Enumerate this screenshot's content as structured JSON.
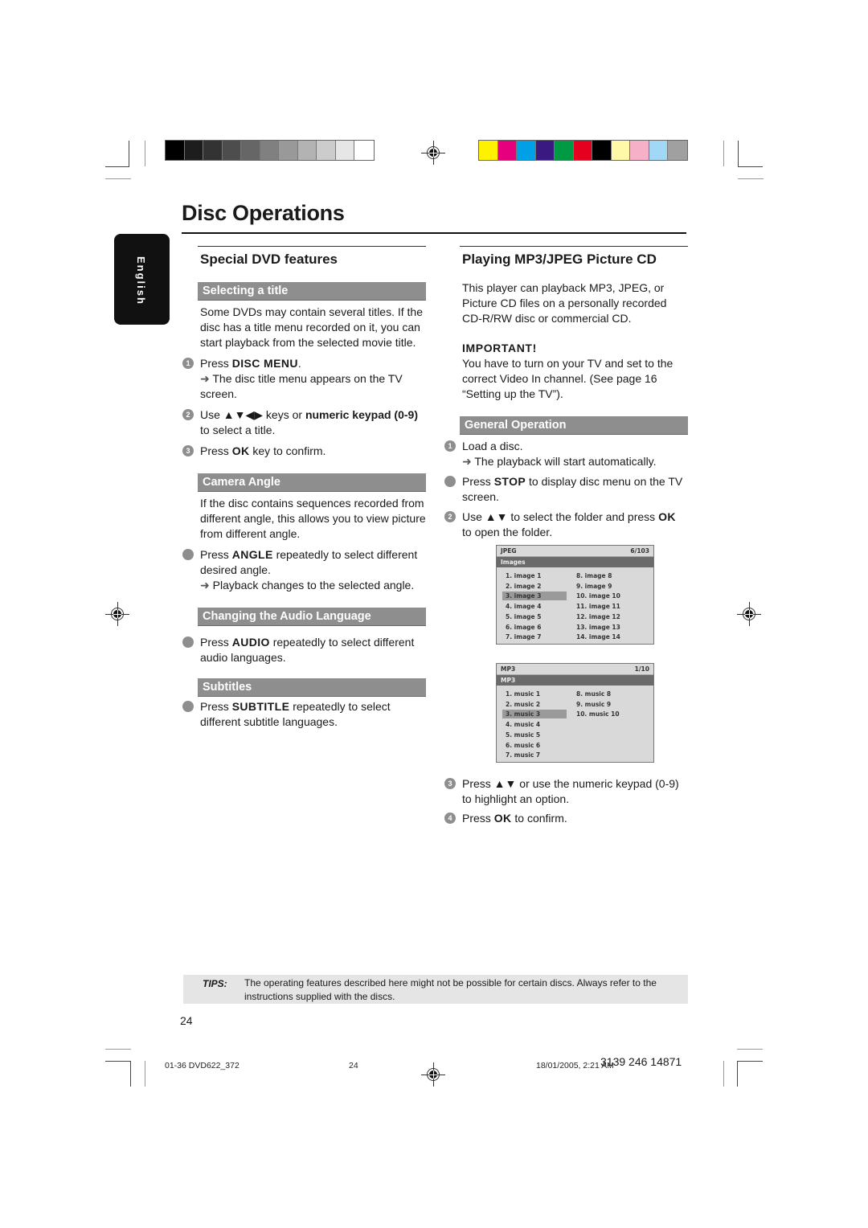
{
  "color_bars": {
    "grayscale": [
      "#000000",
      "#1d1d1d",
      "#333333",
      "#4d4d4d",
      "#666666",
      "#808080",
      "#999999",
      "#b3b3b3",
      "#cccccc",
      "#e6e6e6",
      "#ffffff"
    ],
    "colors": [
      "#fff200",
      "#e6007e",
      "#00a0e9",
      "#3a1a80",
      "#009a44",
      "#e60020",
      "#000000",
      "#fff9a8",
      "#f6b0c8",
      "#a0d8f5",
      "#a0a0a0"
    ]
  },
  "page_title": "Disc Operations",
  "language_tab": "English",
  "left": {
    "title": "Special DVD features",
    "selecting": {
      "heading": "Selecting a title",
      "intro": "Some DVDs may contain several titles. If the disc has a title menu recorded on it, you can start playback from the selected movie title.",
      "steps": [
        {
          "num": "1",
          "pre": "Press ",
          "key": "DISC MENU",
          "post": ".",
          "result": "The disc title menu appears on the TV screen."
        },
        {
          "num": "2",
          "pre": "Use ▲▼◀▶ keys or ",
          "key": "numeric keypad (0-9)",
          "post": " to select a title."
        },
        {
          "num": "3",
          "pre": "Press ",
          "key": "OK",
          "post": " key to confirm."
        }
      ]
    },
    "camera": {
      "heading": "Camera Angle",
      "intro": "If the disc contains sequences recorded from different angle, this allows you to view picture from different angle.",
      "step": {
        "pre": "Press ",
        "key": "ANGLE",
        "post": " repeatedly to select different desired angle.",
        "result": "Playback changes to the selected angle."
      }
    },
    "audio": {
      "heading": "Changing the Audio Language",
      "step": {
        "pre": "Press ",
        "key": "AUDIO",
        "post": " repeatedly to select different audio languages."
      }
    },
    "subtitles": {
      "heading": "Subtitles",
      "step": {
        "pre": "Press ",
        "key": "SUBTITLE",
        "post": " repeatedly to select different subtitle languages."
      }
    }
  },
  "right": {
    "title": "Playing MP3/JPEG Picture CD",
    "intro": "This player can playback MP3, JPEG, or Picture CD files on a personally recorded CD-R/RW disc or commercial CD.",
    "important_label": "IMPORTANT!",
    "important_text": "You have to turn on your TV and set to the correct Video In channel. (See page 16 “Setting up the TV”).",
    "general": {
      "heading": "General Operation",
      "step1": {
        "num": "1",
        "text": "Load a disc.",
        "result": "The playback will start automatically."
      },
      "stop": {
        "pre": "Press ",
        "key": "STOP",
        "post": " to display disc menu on the TV screen."
      },
      "step2": {
        "num": "2",
        "pre": "Use ▲▼ to select the folder and press ",
        "key": "OK",
        "post": " to open the folder."
      },
      "step3": {
        "num": "3",
        "text": "Press ▲▼ or use the numeric keypad (0-9) to highlight an option."
      },
      "step4": {
        "num": "4",
        "pre": "Press ",
        "key": "OK",
        "post": " to confirm."
      }
    },
    "osd_jpeg": {
      "type": "JPEG",
      "count": "6/103",
      "folder": "Images",
      "selected": "3. image 3",
      "col1": [
        "1. image 1",
        "2. image 2",
        "3. image 3",
        "4. image 4",
        "5. image 5",
        "6. image 6",
        "7. image 7"
      ],
      "col2": [
        "8. image 8",
        "9. image 9",
        "10. image 10",
        "11. image 11",
        "12. image 12",
        "13. image 13",
        "14. image 14"
      ]
    },
    "osd_mp3": {
      "type": "MP3",
      "count": "1/10",
      "folder": "MP3",
      "selected": "3. music 3",
      "col1": [
        "1. music 1",
        "2. music 2",
        "3. music 3",
        "4. music 4",
        "5. music 5",
        "6. music 6",
        "7. music 7"
      ],
      "col2": [
        "8. music 8",
        "9. music 9",
        "10. music 10"
      ]
    }
  },
  "tips": {
    "label": "TIPS:",
    "text": "The operating features described here might not be possible for certain discs.  Always refer to the instructions supplied with the discs."
  },
  "page_number": "24",
  "footer": {
    "file": "01-36 DVD622_372",
    "page": "24",
    "date": "18/01/2005, 2:21 AM",
    "code": "3139 246 14871"
  }
}
